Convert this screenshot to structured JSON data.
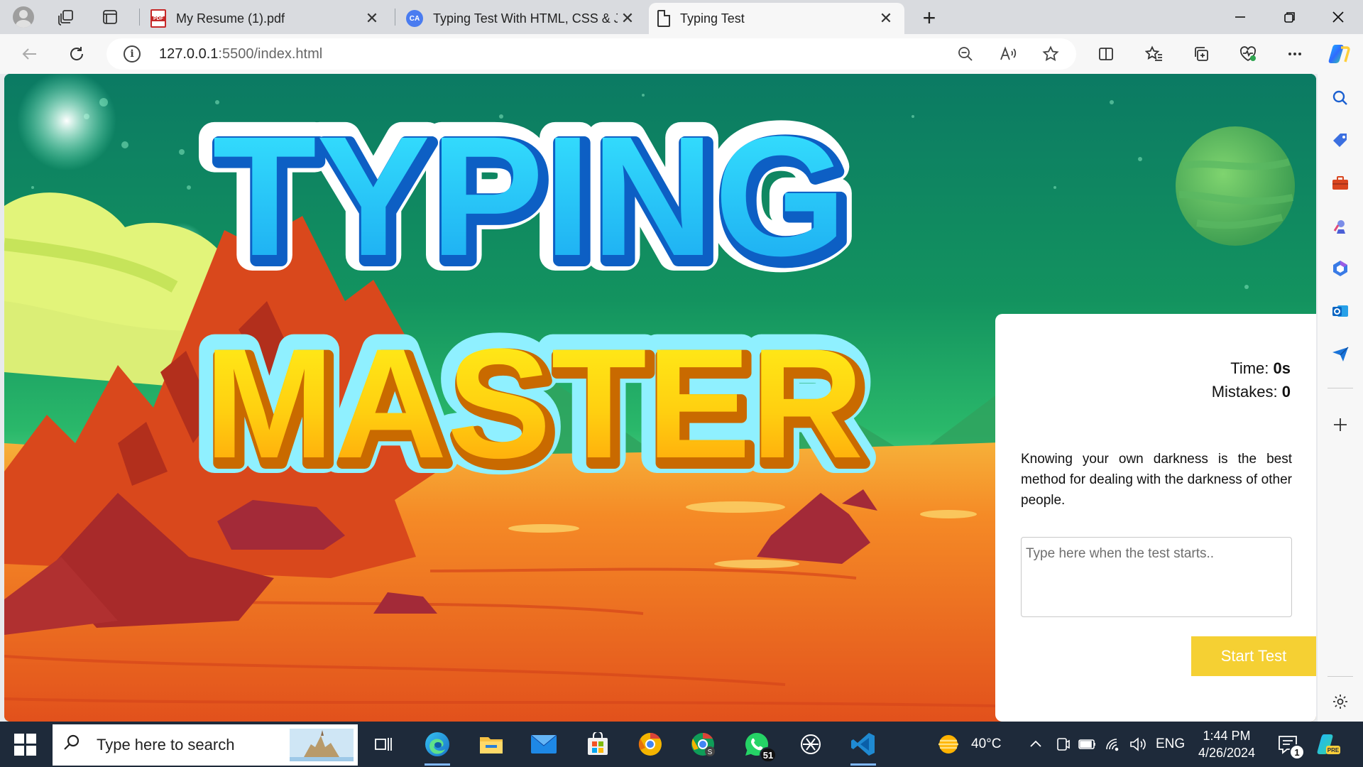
{
  "browser": {
    "tabs": [
      {
        "title": "My Resume (1).pdf",
        "icon": "pdf-icon",
        "active": false
      },
      {
        "title": "Typing Test With HTML, CSS & Ja",
        "icon": "codeacademy-icon",
        "active": false
      },
      {
        "title": "Typing Test",
        "icon": "document-icon",
        "active": true
      }
    ],
    "url_host": "127.0.0.1",
    "url_path": ":5500/index.html"
  },
  "page": {
    "hero_line1": "TYPING",
    "hero_line2": "MASTER",
    "time_label": "Time:",
    "time_value": "0s",
    "mistakes_label": "Mistakes:",
    "mistakes_value": "0",
    "quote": "Knowing your own darkness is the best method for dealing with the darkness of other people.",
    "input_placeholder": "Type here when the test starts..",
    "start_button": "Start Test",
    "colors": {
      "accent_button": "#f5d033",
      "background_top": "#0f7f62"
    }
  },
  "taskbar": {
    "search_placeholder": "Type here to search",
    "whatsapp_badge": "51",
    "notification_badge": "1",
    "weather": "40°C",
    "language": "ENG",
    "time": "1:44 PM",
    "date": "4/26/2024"
  }
}
